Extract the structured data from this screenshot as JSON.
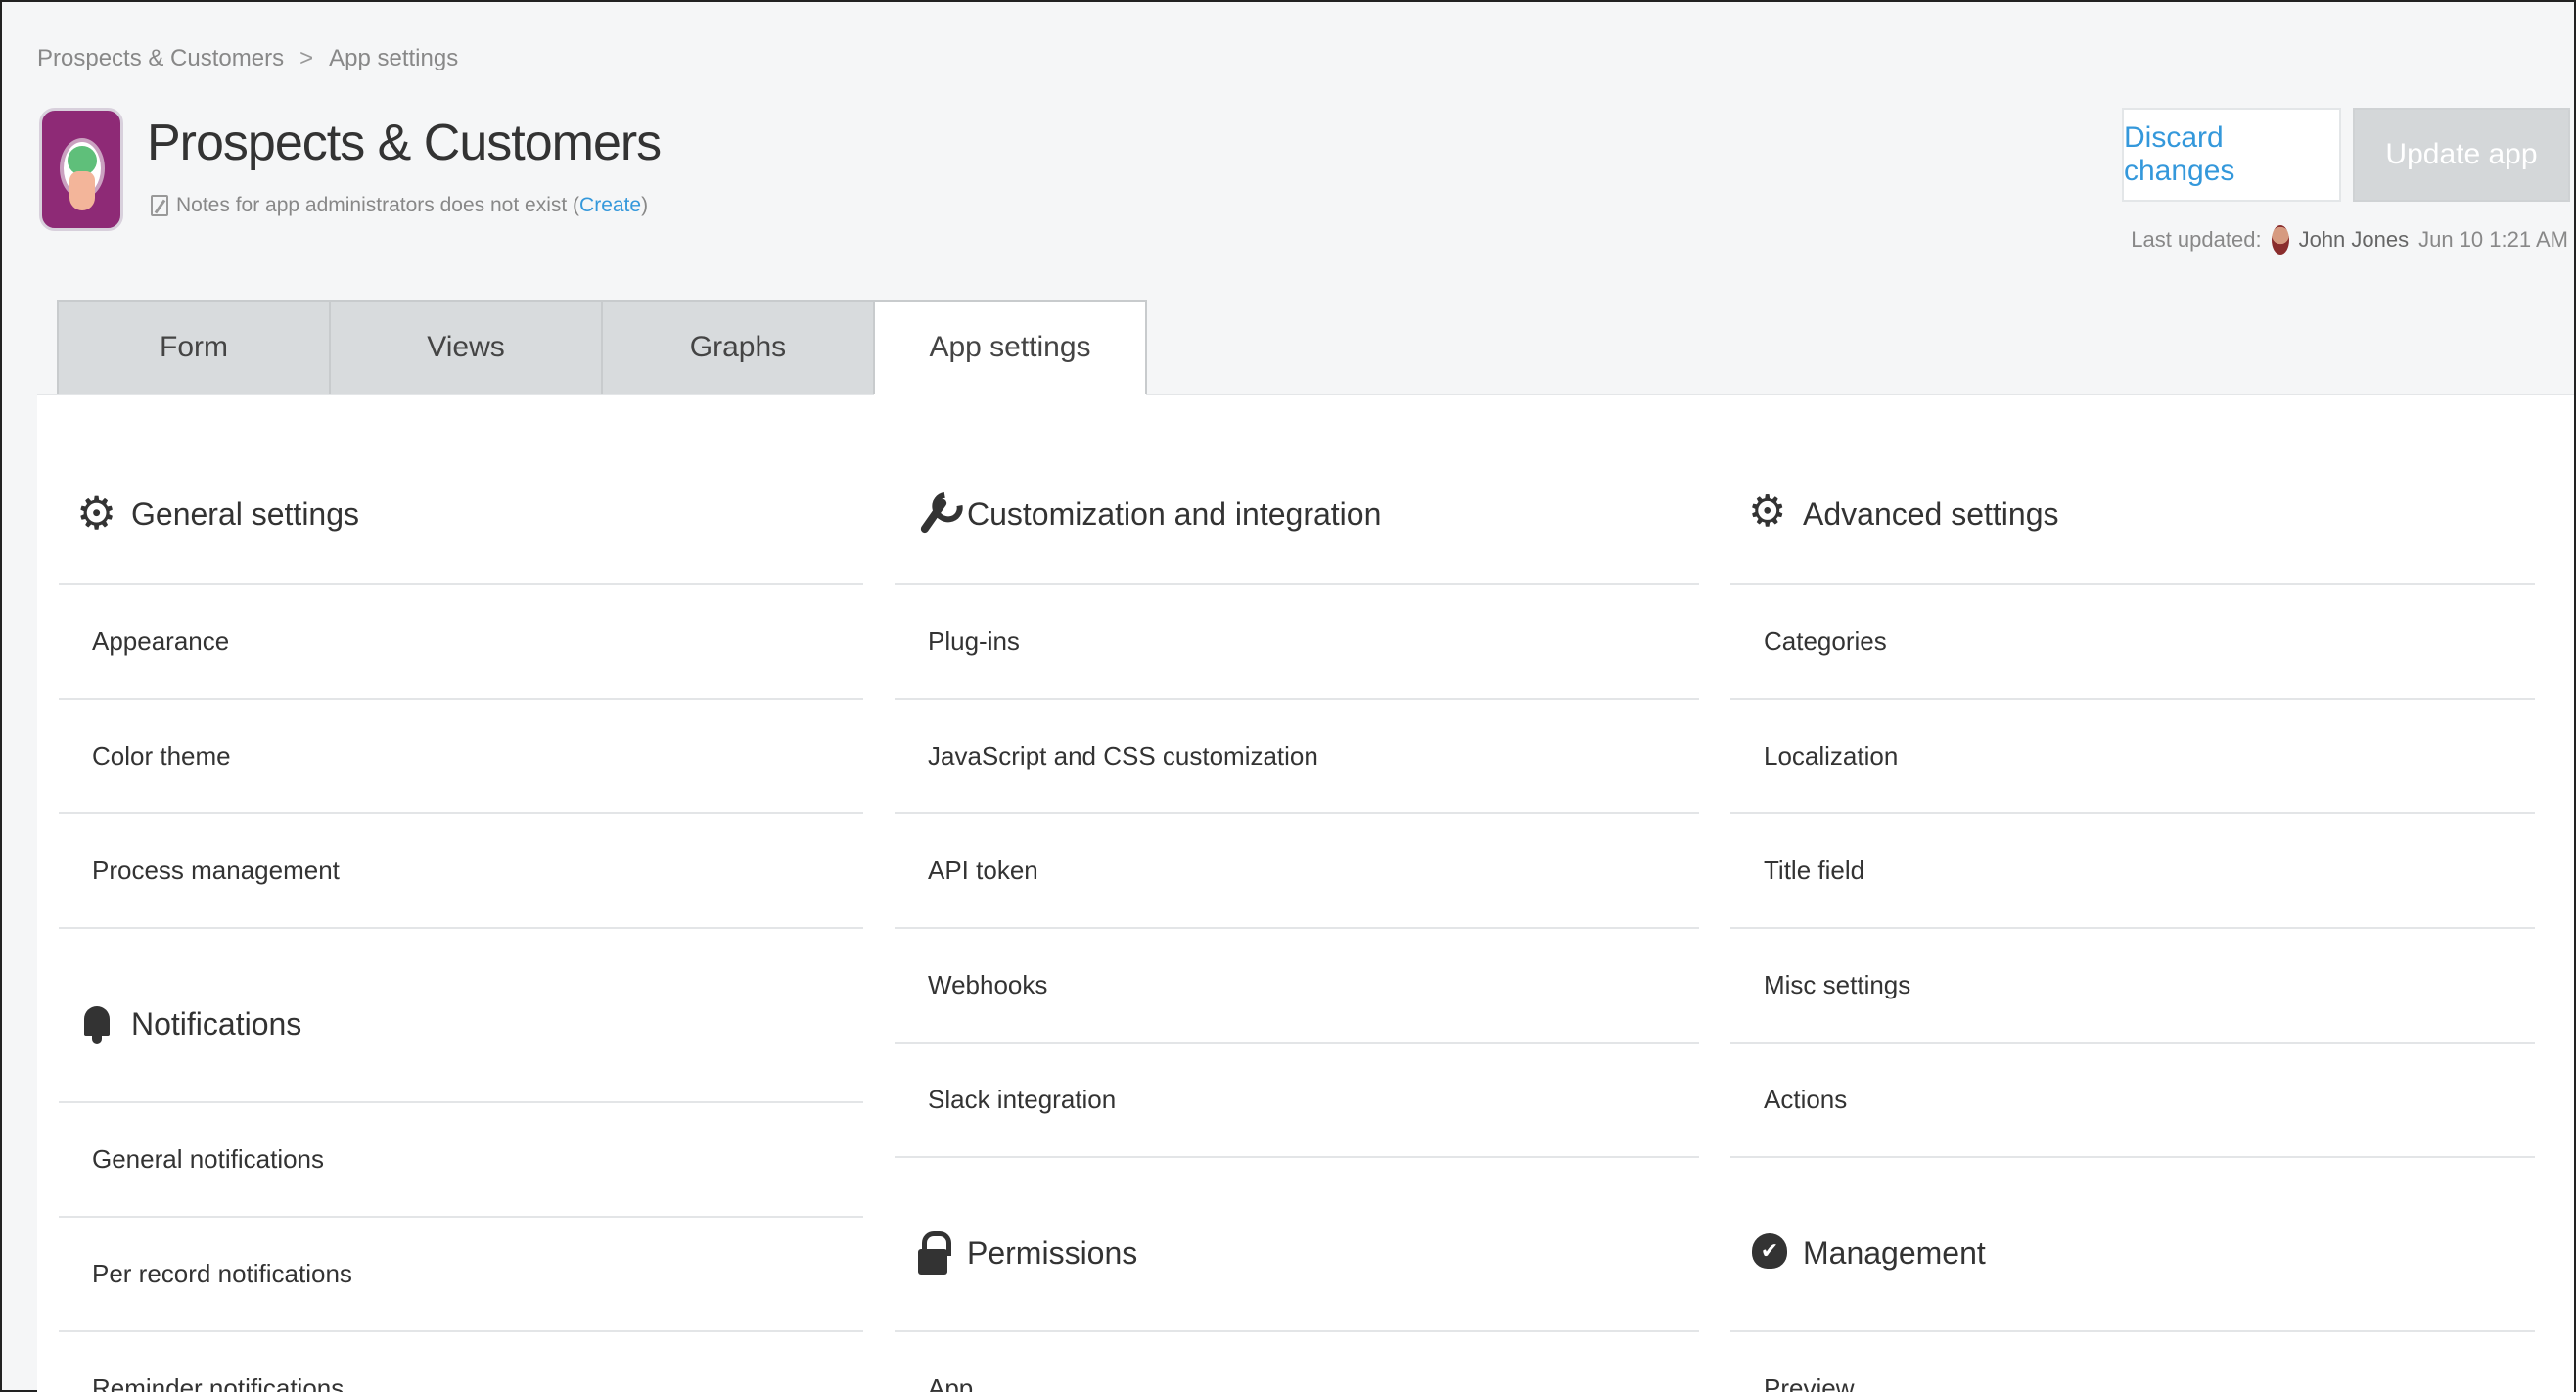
{
  "breadcrumb": {
    "parent": "Prospects & Customers",
    "separator": ">",
    "current": "App settings"
  },
  "app": {
    "title": "Prospects & Customers",
    "note_text": "Notes for app administrators does not exist (",
    "note_link": "Create",
    "note_close": ")"
  },
  "actions": {
    "discard_label": "Discard changes",
    "update_label": "Update app"
  },
  "last_updated": {
    "label": "Last updated:",
    "user": "John Jones",
    "time": "Jun 10 1:21 AM"
  },
  "tabs": [
    {
      "label": "Form",
      "active": false
    },
    {
      "label": "Views",
      "active": false
    },
    {
      "label": "Graphs",
      "active": false
    },
    {
      "label": "App settings",
      "active": true
    }
  ],
  "sections": {
    "general": {
      "title": "General settings",
      "icon": "gear-icon",
      "items": [
        "Appearance",
        "Color theme",
        "Process management"
      ]
    },
    "notifications": {
      "title": "Notifications",
      "icon": "bell-icon",
      "items": [
        "General notifications",
        "Per record notifications",
        "Reminder notifications"
      ]
    },
    "customization": {
      "title": "Customization and integration",
      "icon": "wrench-icon",
      "items": [
        "Plug-ins",
        "JavaScript and CSS customization",
        "API token",
        "Webhooks",
        "Slack integration"
      ]
    },
    "permissions": {
      "title": "Permissions",
      "icon": "lock-icon",
      "items": [
        "App"
      ]
    },
    "advanced": {
      "title": "Advanced settings",
      "icon": "gears-icon",
      "items": [
        "Categories",
        "Localization",
        "Title field",
        "Misc settings",
        "Actions"
      ]
    },
    "management": {
      "title": "Management",
      "icon": "cloud-check-icon",
      "items": [
        "Preview"
      ]
    }
  },
  "colors": {
    "accent": "#3498db",
    "app_icon_bg": "#8e2a76",
    "update_button_bg": "#d4d7d9"
  }
}
